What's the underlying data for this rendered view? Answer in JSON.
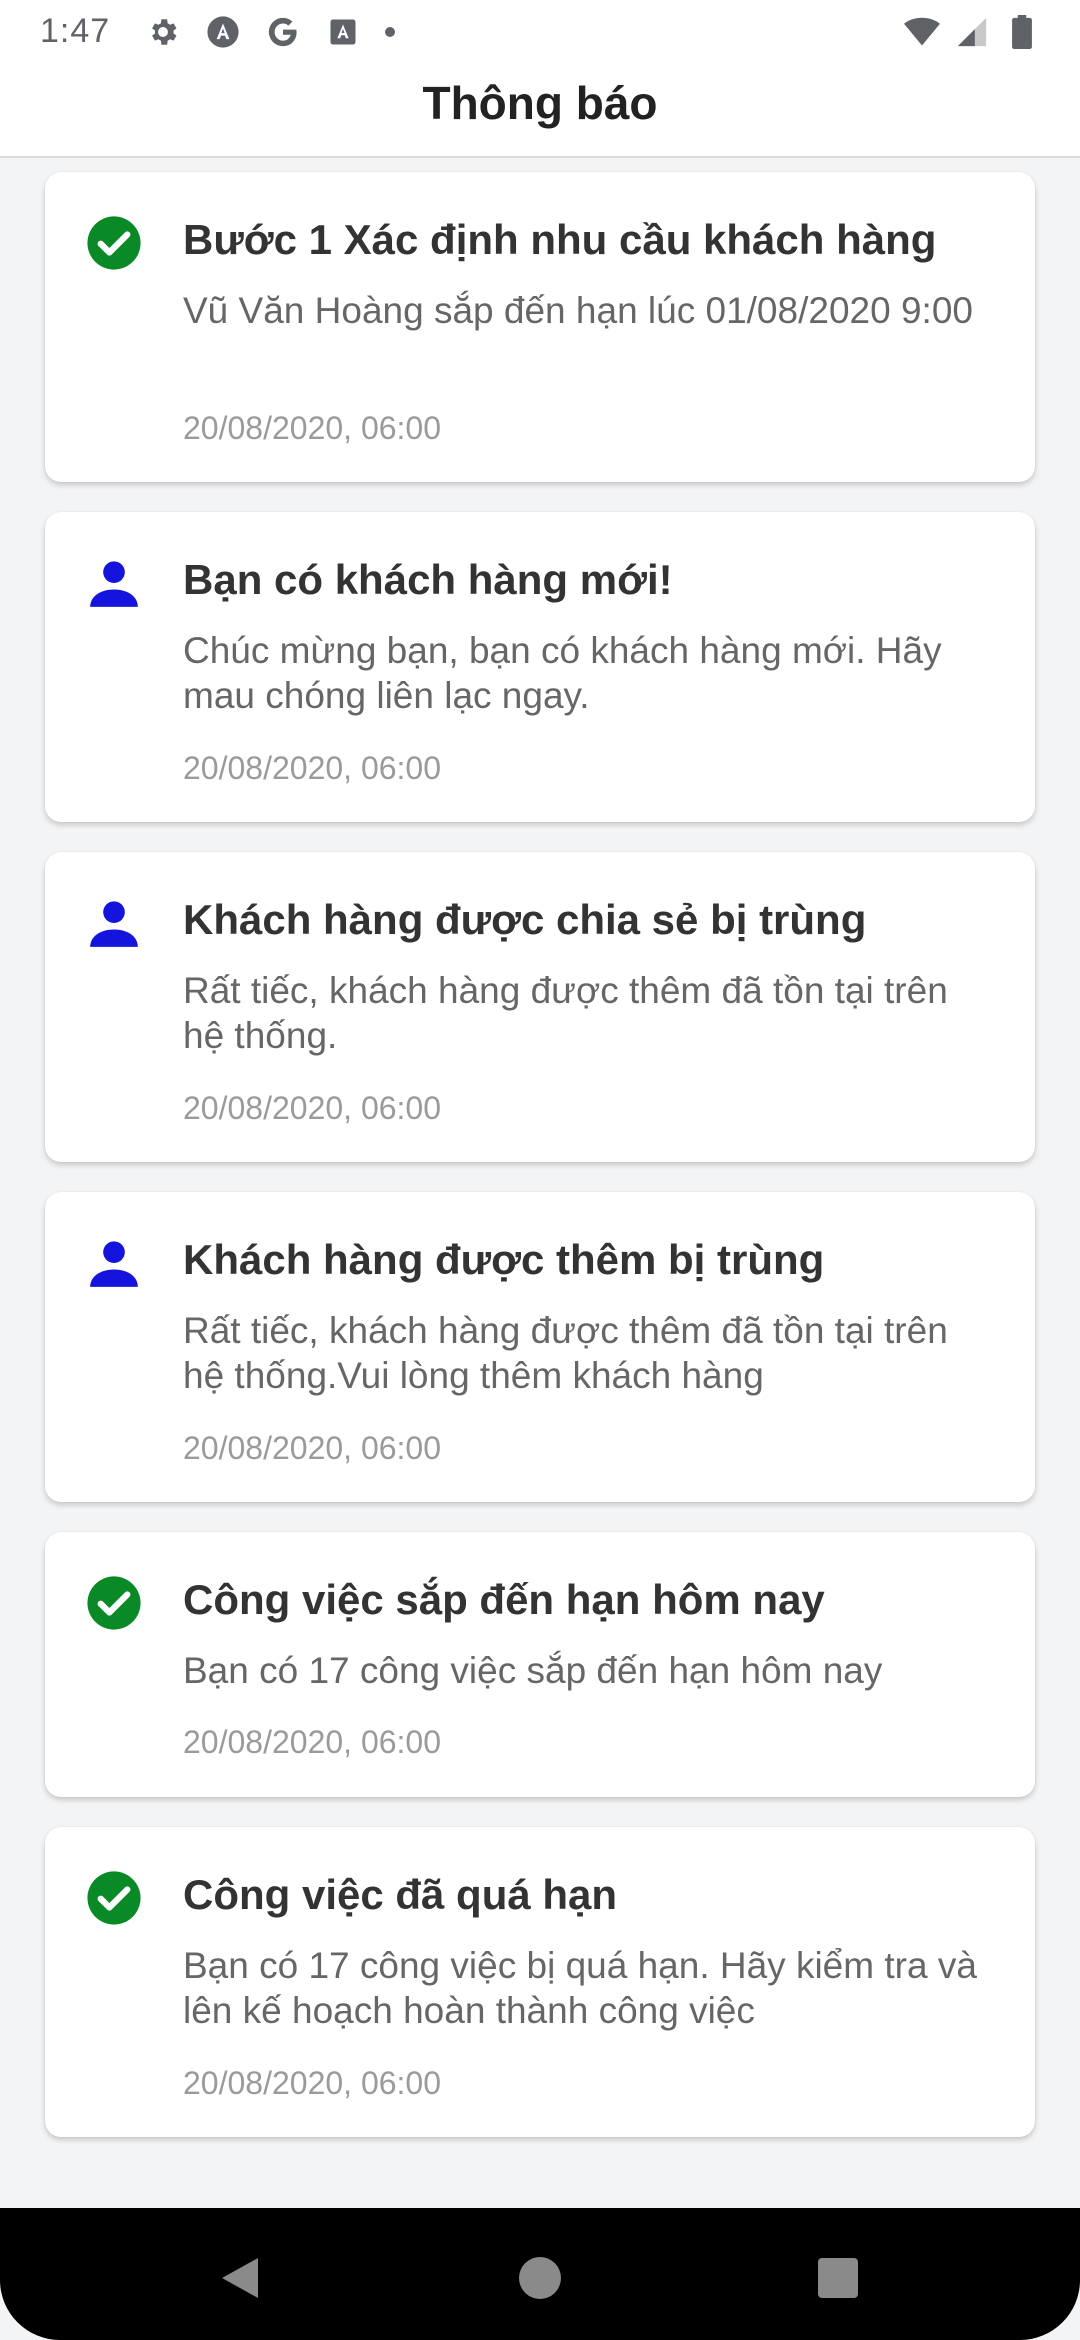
{
  "status_bar": {
    "time": "1:47",
    "left_icons": [
      "gear-icon",
      "a-circle-icon",
      "google-icon",
      "a-box-icon"
    ],
    "right_icons": [
      "wifi-icon",
      "signal-icon",
      "battery-icon"
    ]
  },
  "header": {
    "title": "Thông báo"
  },
  "colors": {
    "success": "#0a8a26",
    "person": "#1414dc"
  },
  "notifications": [
    {
      "icon": "check-circle-icon",
      "title": "Bước 1 Xác định nhu cầu khách hàng",
      "body": "Vũ Văn Hoàng sắp đến hạn lúc 01/08/2020 9:00",
      "time": "20/08/2020, 06:00"
    },
    {
      "icon": "person-icon",
      "title": "Bạn có khách hàng mới!",
      "body": "Chúc mừng bạn, bạn có khách hàng mới. Hãy mau chóng liên lạc ngay.",
      "time": "20/08/2020, 06:00"
    },
    {
      "icon": "person-icon",
      "title": "Khách hàng được chia sẻ bị trùng",
      "body": "Rất tiếc, khách hàng được thêm đã tồn tại trên hệ thống.",
      "time": "20/08/2020, 06:00"
    },
    {
      "icon": "person-icon",
      "title": "Khách hàng được thêm bị trùng",
      "body": "Rất tiếc, khách hàng được thêm đã tồn tại trên hệ thống.Vui lòng thêm khách hàng",
      "time": "20/08/2020, 06:00"
    },
    {
      "icon": "check-circle-icon",
      "title": "Công việc sắp đến hạn hôm nay",
      "body": "Bạn có 17 công việc sắp đến hạn hôm nay",
      "time": "20/08/2020, 06:00"
    },
    {
      "icon": "check-circle-icon",
      "title": "Công việc đã quá hạn",
      "body": "Bạn có 17 công việc bị quá hạn. Hãy kiểm tra và lên kế hoạch hoàn thành công việc",
      "time": "20/08/2020, 06:00"
    }
  ],
  "nav": {
    "buttons": [
      "back-icon",
      "home-icon",
      "recents-icon"
    ]
  }
}
